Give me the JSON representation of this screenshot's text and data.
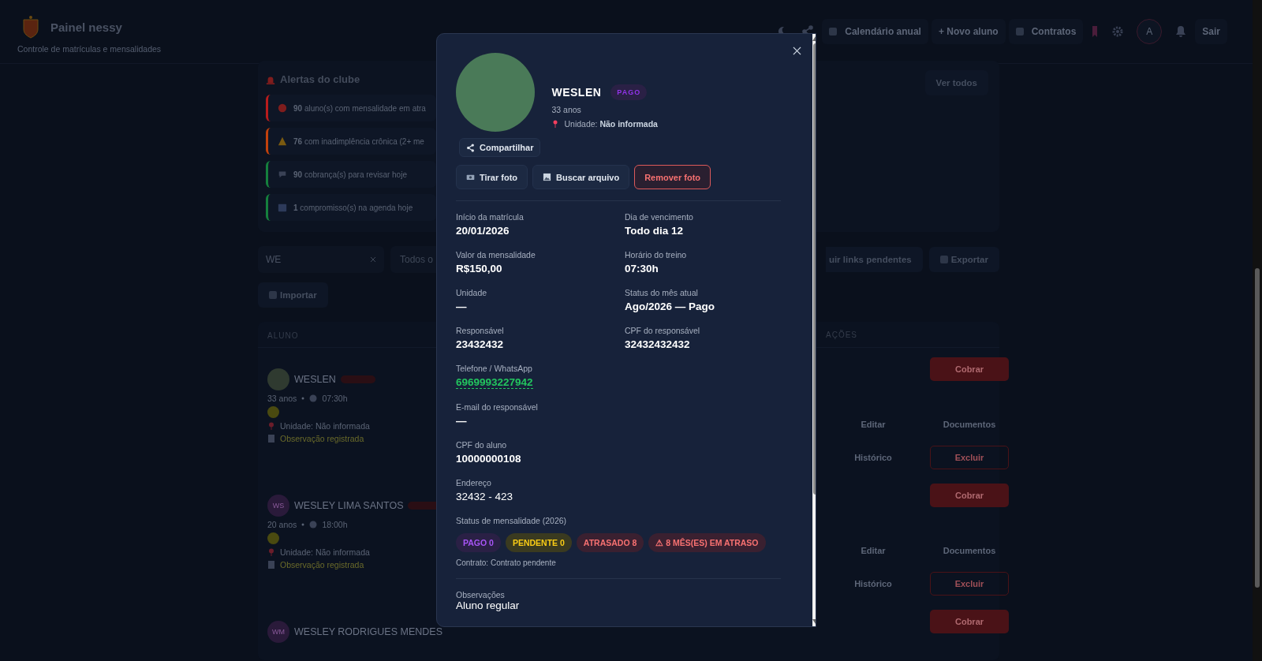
{
  "header": {
    "title": "Painel nessy",
    "subtitle": "Controle de matrículas e mensalidades",
    "nav_buttons": [
      "Calendário anual",
      "+ Novo aluno",
      "Contratos"
    ],
    "avatar_letter": "A",
    "logout": "Sair"
  },
  "alerts": {
    "title": "Alertas do clube",
    "view_all": "Ver todos",
    "items": [
      {
        "kind": "dot",
        "count": "90",
        "text": "aluno(s) com mensalidade em atra",
        "color": "#b91c1c"
      },
      {
        "kind": "warning",
        "count": "76",
        "text": "com inadimplência crônica (2+ me",
        "color": "#c2410c"
      },
      {
        "kind": "chat",
        "count": "90",
        "text": "cobrança(s) para revisar hoje",
        "color": "#15803d"
      },
      {
        "kind": "calendar",
        "count": "1",
        "text": "compromisso(s) na agenda hoje",
        "color": "#15803d"
      }
    ]
  },
  "filters": {
    "search_value": "WE",
    "select_partial": "Todos o",
    "bulk_button": "uir links pendentes",
    "export_button": "Exportar",
    "import_button": "Importar"
  },
  "table": {
    "columns": [
      "ALUNO",
      "AÇÕES"
    ],
    "rows": [
      {
        "name": "WESLEN",
        "photo": true,
        "initials": "",
        "age": "33 anos",
        "time": "07:30h",
        "unit_label": "Unidade:",
        "unit_value": "Não informada",
        "note": "Observação registrada",
        "actions": [
          {
            "label": "Cobrar",
            "kind": "primary"
          },
          {
            "label": "Editar",
            "kind": "plain"
          },
          {
            "label": "Documentos",
            "kind": "plain"
          },
          {
            "label": "Histórico",
            "kind": "plain"
          },
          {
            "label": "Excluir",
            "kind": "danger"
          }
        ]
      },
      {
        "name": "WESLEY LIMA SANTOS",
        "photo": false,
        "initials": "WS",
        "age": "20 anos",
        "time": "18:00h",
        "unit_label": "Unidade:",
        "unit_value": "Não informada",
        "note": "Observação registrada",
        "actions": [
          {
            "label": "Cobrar",
            "kind": "primary"
          },
          {
            "label": "Editar",
            "kind": "plain"
          },
          {
            "label": "Documentos",
            "kind": "plain"
          },
          {
            "label": "Histórico",
            "kind": "plain"
          },
          {
            "label": "Excluir",
            "kind": "danger"
          }
        ]
      },
      {
        "name": "WESLEY RODRIGUES MENDES",
        "photo": false,
        "initials": "WM",
        "actions": [
          {
            "label": "Cobrar",
            "kind": "primary"
          }
        ]
      }
    ]
  },
  "modal": {
    "name": "WESLEN",
    "badge": "PAGO",
    "age": "33 anos",
    "unit_label": "Unidade:",
    "unit_value": "Não informada",
    "share_button": "Compartilhar",
    "photo_buttons": [
      {
        "label": "Tirar foto",
        "kind": "camera"
      },
      {
        "label": "Buscar arquivo",
        "kind": "file"
      },
      {
        "label": "Remover foto",
        "kind": "danger"
      }
    ],
    "field_rows": [
      [
        {
          "label": "Início da matrícula",
          "value": "20/01/2026",
          "kind": "bold"
        },
        {
          "label": "Dia de vencimento",
          "value": "Todo dia 12",
          "kind": "bold"
        }
      ],
      [
        {
          "label": "Valor da mensalidade",
          "value": "R$150,00",
          "kind": "bold"
        },
        {
          "label": "Horário do treino",
          "value": "07:30h",
          "kind": "bold"
        }
      ],
      [
        {
          "label": "Unidade",
          "value": "—",
          "kind": "bold"
        },
        {
          "label": "Status do mês atual",
          "value": "Ago/2026 — Pago",
          "kind": "bold"
        }
      ],
      [
        {
          "label": "Responsável",
          "value": "23432432",
          "kind": "bold"
        },
        {
          "label": "CPF do responsável",
          "value": "32432432432",
          "kind": "bold"
        }
      ],
      [
        {
          "label": "Telefone / WhatsApp",
          "value": "6969993227942",
          "kind": "link"
        }
      ],
      [
        {
          "label": "E-mail do responsável",
          "value": "—",
          "kind": "bold"
        }
      ],
      [
        {
          "label": "CPF do aluno",
          "value": "10000000108",
          "kind": "bold"
        }
      ],
      [
        {
          "label": "Endereço",
          "value": "32432 - 423",
          "kind": "plain"
        }
      ]
    ],
    "status_label": "Status de mensalidade (2026)",
    "chips": [
      {
        "label": "PAGO 0",
        "kind": "paid"
      },
      {
        "label": "PENDENTE 0",
        "kind": "pending"
      },
      {
        "label": "ATRASADO 8",
        "kind": "late"
      },
      {
        "label": "⚠ 8 MÊS(ES) EM ATRASO",
        "kind": "late"
      }
    ],
    "contract": "Contrato: Contrato pendente",
    "notes_label": "Observações",
    "notes_value": "Aluno regular"
  }
}
